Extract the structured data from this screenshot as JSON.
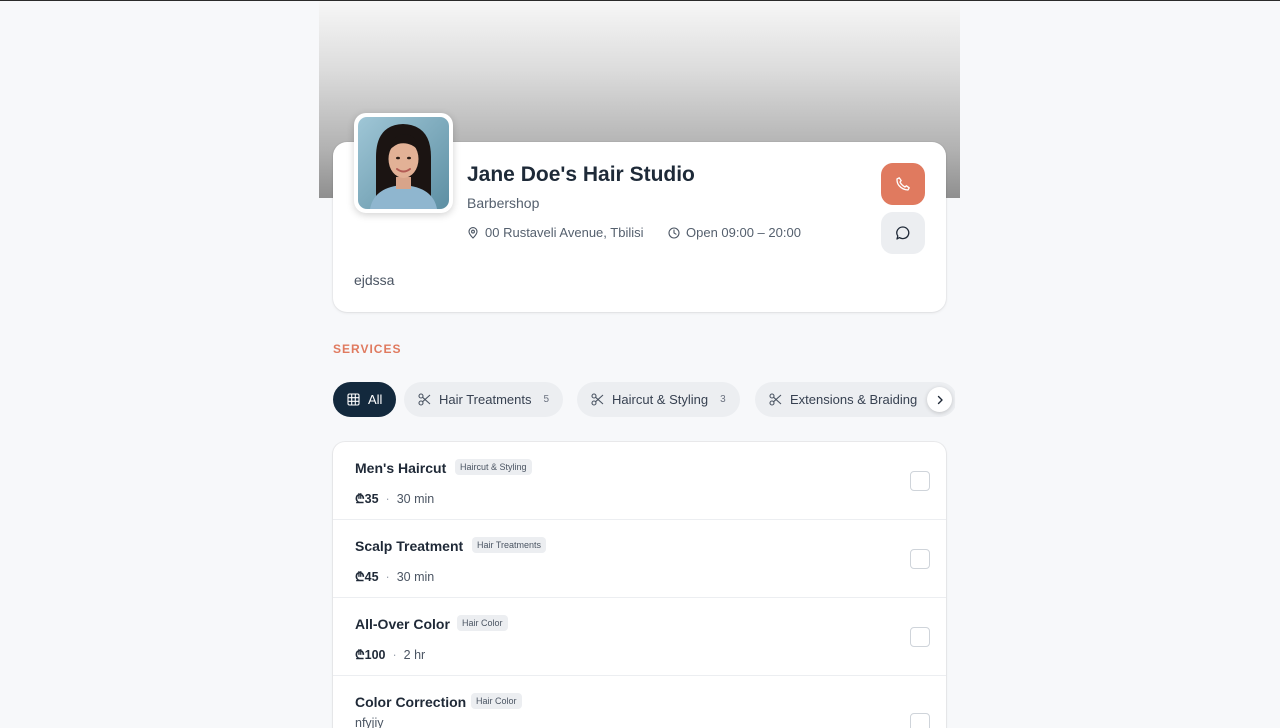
{
  "profile": {
    "name": "Jane Doe's Hair Studio",
    "type": "Barbershop",
    "address": "00 Rustaveli Avenue, Tbilisi",
    "hours": "Open 09:00 – 20:00",
    "description": "ejdssa"
  },
  "section_title": "SERVICES",
  "categories": [
    {
      "label": "All",
      "count": "",
      "icon": "grid-icon",
      "active": true
    },
    {
      "label": "Hair Treatments",
      "count": "5",
      "icon": "scissors-icon",
      "active": false
    },
    {
      "label": "Haircut & Styling",
      "count": "3",
      "icon": "scissors-icon",
      "active": false
    },
    {
      "label": "Extensions & Braiding",
      "count": "",
      "icon": "scissors-icon",
      "active": false
    }
  ],
  "services": [
    {
      "name": "Men's Haircut",
      "tag": "Haircut & Styling",
      "price": "₾35",
      "duration": "30 min"
    },
    {
      "name": "Scalp Treatment",
      "tag": "Hair Treatments",
      "price": "₾45",
      "duration": "30 min"
    },
    {
      "name": "All-Over Color",
      "tag": "Hair Color",
      "price": "₾100",
      "duration": "2 hr"
    },
    {
      "name": "Color Correction",
      "tag": "Hair Color",
      "price": "",
      "duration": "",
      "note": "nfyjiy"
    }
  ],
  "colors": {
    "accent": "#e07a5f",
    "active_chip": "#13293d",
    "background": "#f7f8fa"
  }
}
